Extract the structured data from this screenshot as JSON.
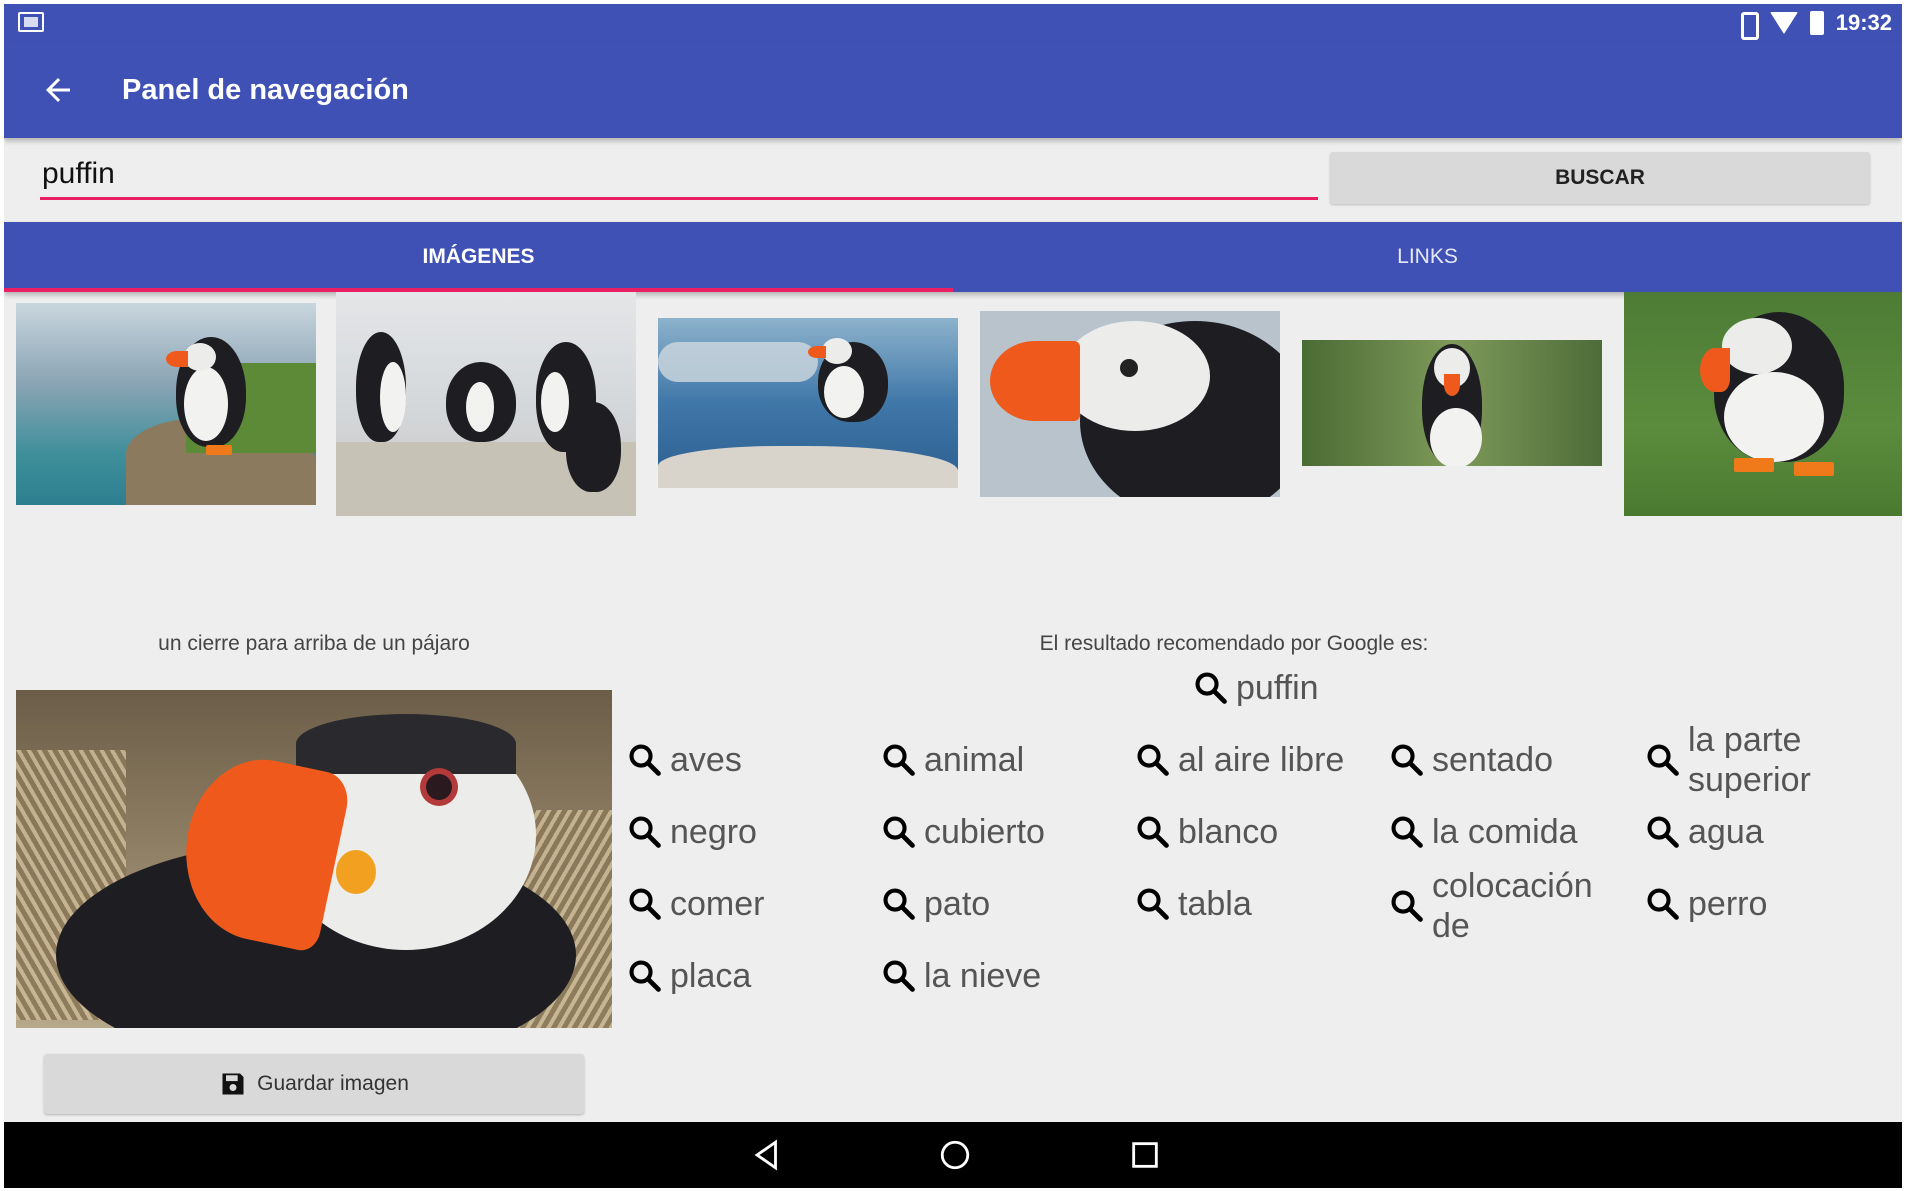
{
  "status_bar": {
    "time": "19:32"
  },
  "toolbar": {
    "title": "Panel de navegación"
  },
  "search": {
    "value": "puffin",
    "button_label": "BUSCAR"
  },
  "tabs": [
    {
      "label": "IMÁGENES",
      "active": true
    },
    {
      "label": "LINKS",
      "active": false
    }
  ],
  "result": {
    "image_caption": "un cierre para arriba de un pájaro",
    "recommendation_label": "El resultado recomendado por Google es:",
    "recommended_term": "puffin",
    "save_label": "Guardar imagen"
  },
  "tags": [
    [
      "aves",
      "animal",
      "al aire libre",
      "sentado",
      "la parte superior"
    ],
    [
      "negro",
      "cubierto",
      "blanco",
      "la comida",
      "agua"
    ],
    [
      "comer",
      "pato",
      "tabla",
      "colocación de",
      "perro"
    ],
    [
      "placa",
      "la nieve"
    ]
  ],
  "colors": {
    "primary": "#3f51b5",
    "accent": "#e91e63",
    "background": "#eeeeee"
  },
  "icons": [
    "back-arrow-icon",
    "search-icon",
    "save-icon",
    "nav-back-icon",
    "nav-home-icon",
    "nav-recents-icon"
  ]
}
